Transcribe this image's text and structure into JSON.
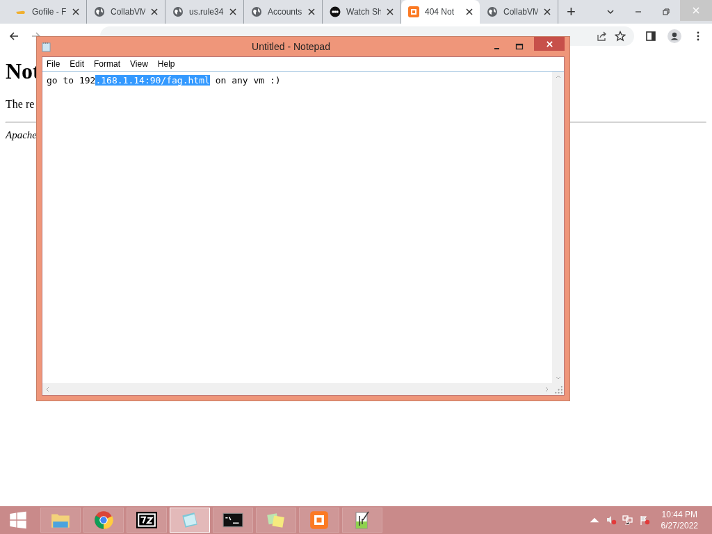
{
  "browser": {
    "tabs": [
      {
        "kind": "hand",
        "title": "Gofile - F",
        "selected": false
      },
      {
        "kind": "globe",
        "title": "CollabVM",
        "selected": false
      },
      {
        "kind": "globe",
        "title": "us.rule34",
        "selected": false
      },
      {
        "kind": "globe",
        "title": "Accounts",
        "selected": false
      },
      {
        "kind": "abc",
        "title": "Watch Sh",
        "selected": false
      },
      {
        "kind": "xampp",
        "title": "404 Not",
        "selected": true
      },
      {
        "kind": "globe",
        "title": "CollabVM",
        "selected": false
      }
    ],
    "new_tab": "+",
    "page": {
      "heading": "Not",
      "paragraph": "The re",
      "footer": "Apache"
    }
  },
  "notepad": {
    "title": "Untitled - Notepad",
    "menu": [
      "File",
      "Edit",
      "Format",
      "View",
      "Help"
    ],
    "text": [
      {
        "text": "go to 192",
        "selected": false
      },
      {
        "text": ".168.1.14:90/fag.html",
        "selected": true
      },
      {
        "text": " on any vm :)",
        "selected": false
      }
    ]
  },
  "taskbar": {
    "apps": [
      {
        "kind": "explorer",
        "selected": false
      },
      {
        "kind": "chrome",
        "selected": false
      },
      {
        "kind": "sevenzip",
        "selected": false
      },
      {
        "kind": "notepad",
        "selected": true
      },
      {
        "kind": "cmd",
        "selected": false
      },
      {
        "kind": "notes",
        "selected": false
      },
      {
        "kind": "xampp",
        "selected": false
      },
      {
        "kind": "notepadpp",
        "selected": false
      }
    ],
    "time": "10:44 PM",
    "date": "6/27/2022"
  }
}
